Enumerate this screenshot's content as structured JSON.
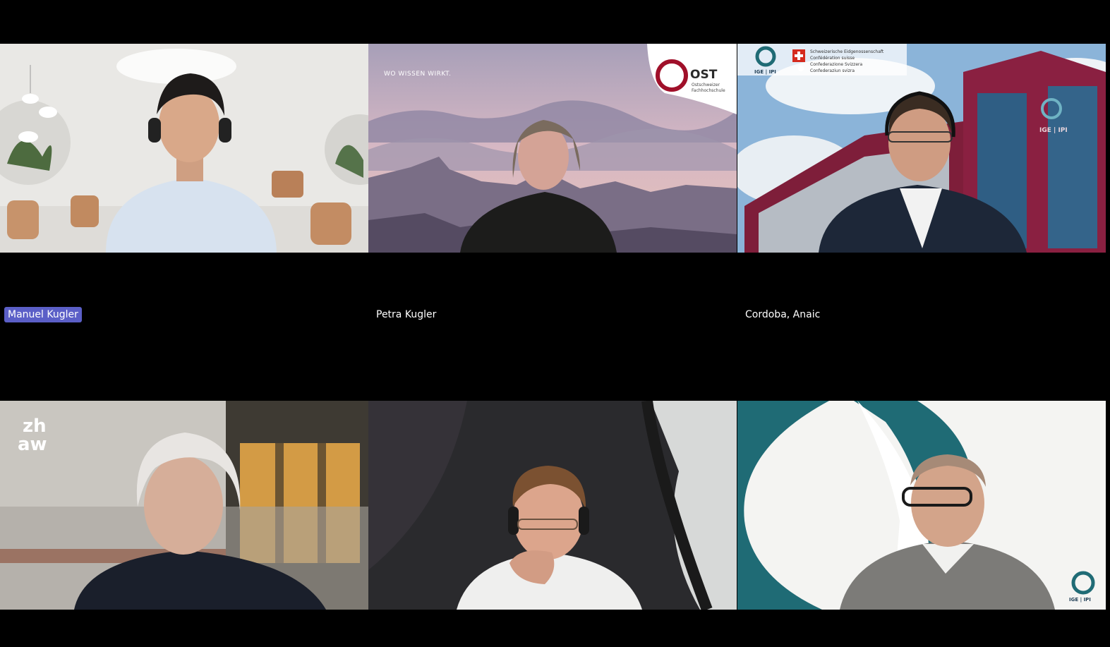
{
  "participants": [
    {
      "name": "Manuel Kugler",
      "speaking": true
    },
    {
      "name": "Petra Kugler",
      "speaking": false
    },
    {
      "name": "Cordoba, Anaic",
      "speaking": false
    },
    {
      "name": "",
      "speaking": false
    },
    {
      "name": "",
      "speaking": false
    },
    {
      "name": "",
      "speaking": false
    }
  ],
  "backgrounds": {
    "ost": {
      "tagline": "WO WISSEN WIRKT.",
      "logo": "OST",
      "sub1": "Ostschweizer",
      "sub2": "Fachhochschule"
    },
    "ige": {
      "logo": "IGE | IPI",
      "swiss1": "Schweizerische Eidgenossenschaft",
      "swiss2": "Confédération suisse",
      "swiss3": "Confederazione Svizzera",
      "swiss4": "Confederaziun svizra",
      "building_sign": "IGE | IPI"
    },
    "zhaw": {
      "line1": "zh",
      "line2": "aw"
    },
    "ige2": {
      "logo": "IGE | IPI"
    }
  },
  "colors": {
    "active_label": "#5b5fc7",
    "accent_teal": "#1f6b75",
    "ost_red": "#a0102a"
  }
}
